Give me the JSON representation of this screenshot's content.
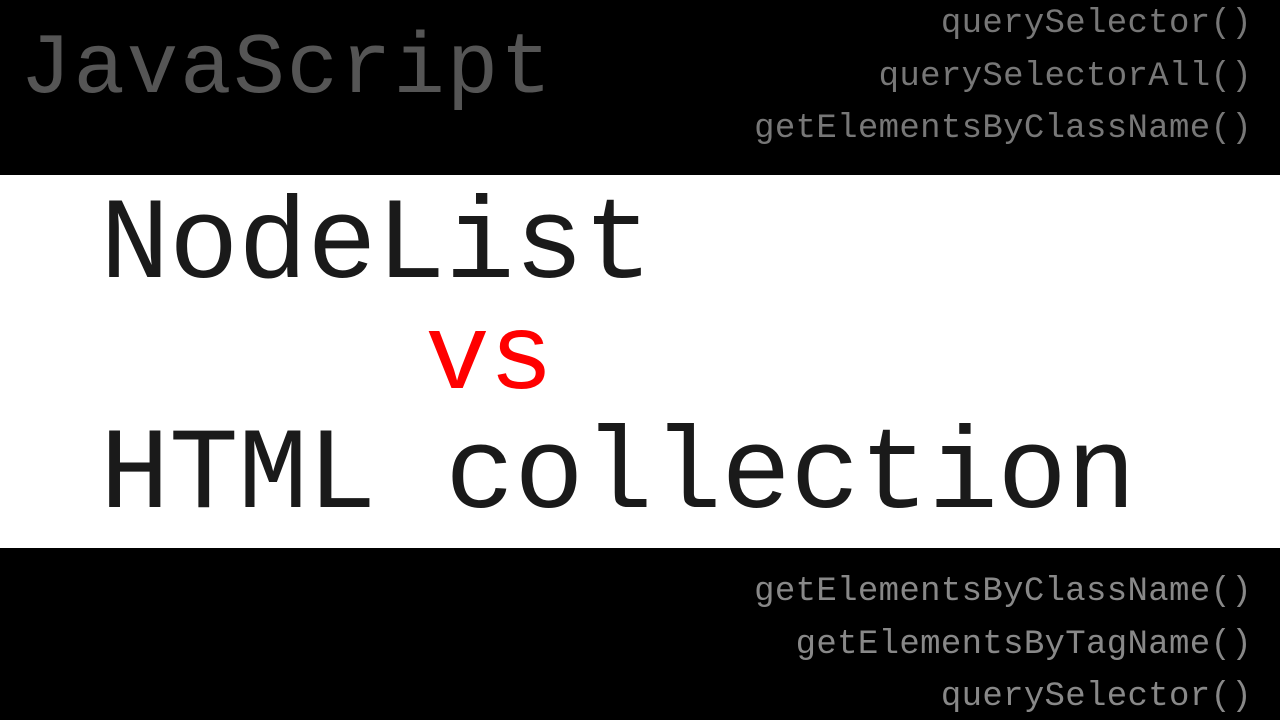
{
  "header": {
    "title": "JavaScript",
    "methods": [
      "querySelector()",
      "querySelectorAll()",
      "getElementsByClassName()"
    ]
  },
  "middle": {
    "line1": "NodeList",
    "line2": "vs",
    "line3": "HTML collection"
  },
  "footer": {
    "methods": [
      "getElementsByClassName()",
      "getElementsByTagName()",
      "querySelector()"
    ]
  }
}
